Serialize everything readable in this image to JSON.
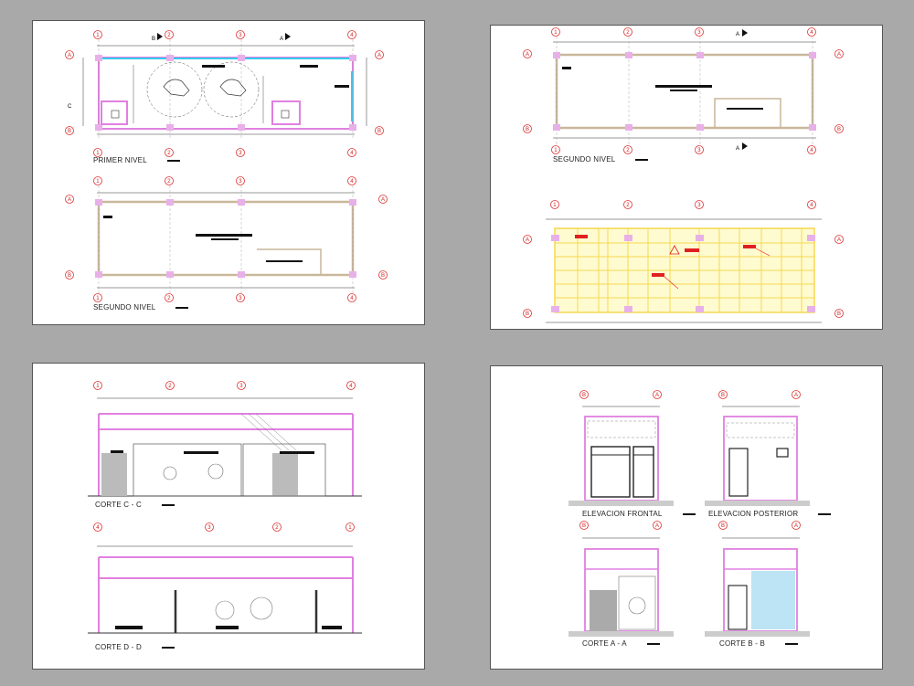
{
  "colors": {
    "background": "#a9a9a9",
    "sheet": "#ffffff",
    "grid_bubble": "#dd3333",
    "wall_pink": "#e080e0",
    "column": "#e8b0e8",
    "glazing_cyan": "#33ccee",
    "steel_yellow": "#f5d850",
    "steel_fill": "#fffbd0"
  },
  "plans": {
    "primer_nivel": "PRIMER NIVEL",
    "segundo_nivel_left": "SEGUNDO NIVEL",
    "segundo_nivel_right": "SEGUNDO NIVEL"
  },
  "sections": {
    "corte_c": "CORTE C - C",
    "corte_d": "CORTE D - D",
    "corte_a": "CORTE A - A",
    "corte_b": "CORTE B - B"
  },
  "elevations": {
    "frontal": "ELEVACION FRONTAL",
    "posterior": "ELEVACION POSTERIOR"
  },
  "axes": {
    "numbers": [
      "1",
      "2",
      "3",
      "4"
    ],
    "letters_ab": [
      "A",
      "B"
    ],
    "letters_ba": [
      "B",
      "A"
    ],
    "section_marks": [
      "A",
      "B",
      "C"
    ]
  }
}
